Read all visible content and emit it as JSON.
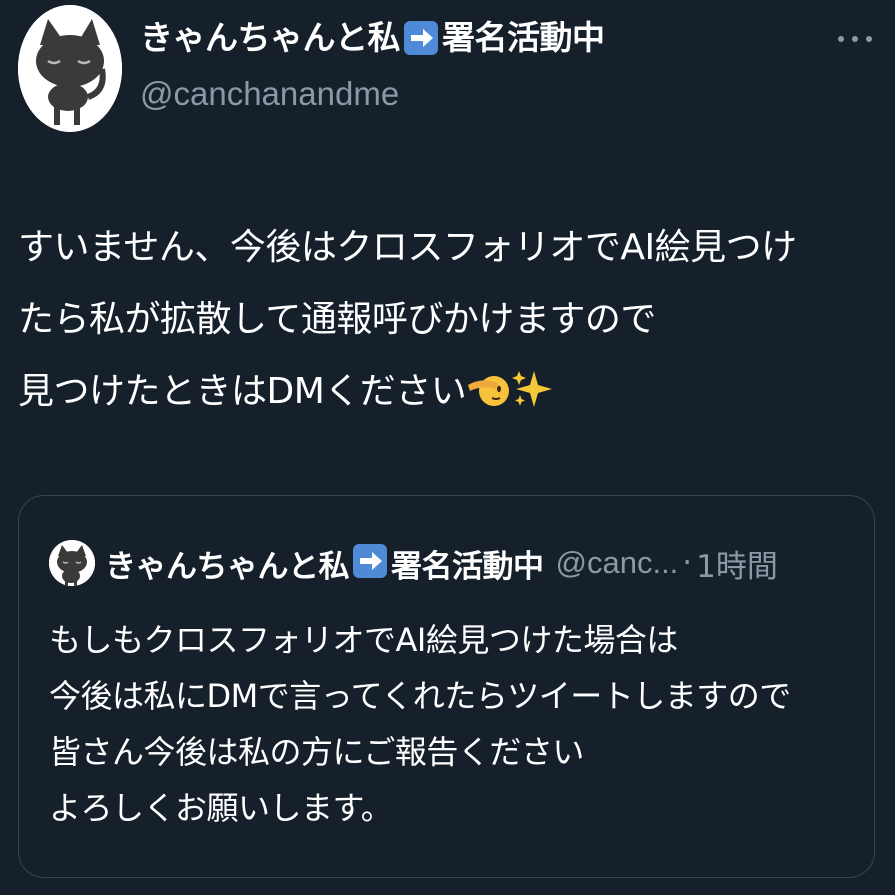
{
  "tweet": {
    "author": {
      "name_before_emoji": "きゃんちゃんと私",
      "name_after_emoji": "署名活動中",
      "handle": "@canchanandme",
      "avatar_icon": "black-cat-avatar-icon"
    },
    "menu_icon": "more-dots-icon",
    "text_lines": [
      "すいません、今後はクロスフォリオでAI絵見つけ",
      "たら私が拡散して通報呼びかけますので",
      "見つけたときはDMください"
    ],
    "trailing_emojis": [
      "saluting-face-emoji",
      "sparkles-emoji"
    ]
  },
  "quoted_tweet": {
    "author": {
      "name_before_emoji": "きゃんちゃんと私",
      "name_after_emoji": "署名活動中",
      "handle_truncated": "@canc...",
      "separator": "·",
      "time": "1時間"
    },
    "text_lines": [
      "もしもクロスフォリオでAI絵見つけた場合は",
      "今後は私にDMで言ってくれたらツイートしますので",
      "皆さん今後は私の方にご報告ください",
      "よろしくお願いします。"
    ]
  },
  "colors": {
    "background": "#15202b",
    "text": "#ffffff",
    "secondary_text": "#8b98a5",
    "border": "#38444d",
    "arrow_badge": "#4f8ad6"
  }
}
